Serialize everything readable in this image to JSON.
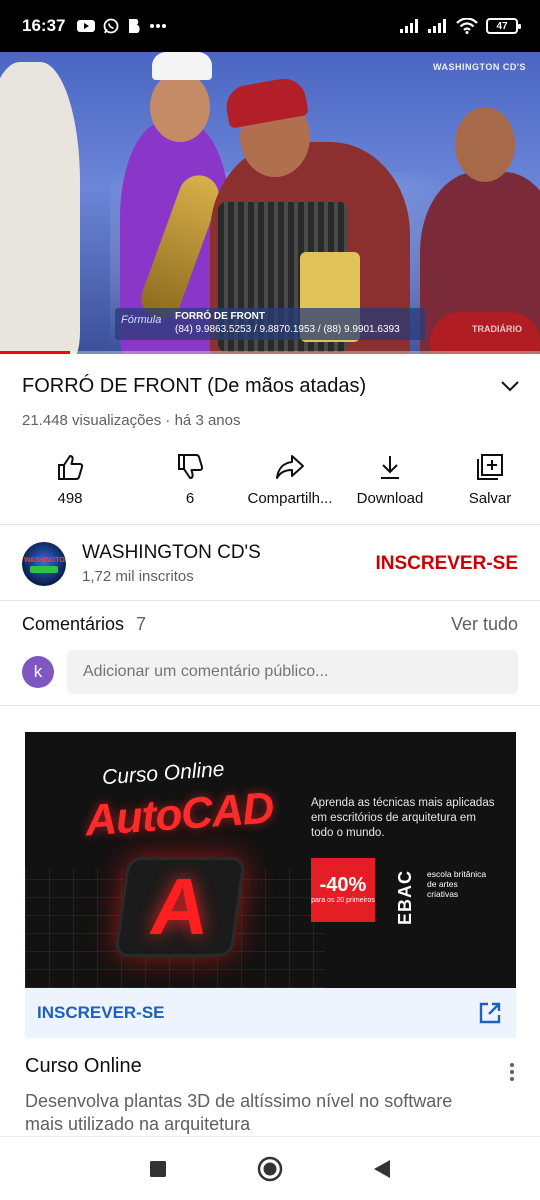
{
  "status_bar": {
    "time": "16:37",
    "left_icons": [
      "youtube-icon",
      "whatsapp-icon",
      "app-b-icon",
      "more-dots-icon"
    ],
    "right_icons": [
      "signal-icon",
      "signal-icon",
      "wifi-icon",
      "battery-icon"
    ],
    "battery": "47"
  },
  "video": {
    "watermark": "WASHINGTON CD'S",
    "lower_third_logo": "Fórmula",
    "lower_third_title": "FORRÓ DE FRONT",
    "lower_third_phones": "(84) 9.9863.5253 / 9.8870.1953 / (88) 9.9901.6393",
    "corner_logo": "TRADIÁRIO",
    "progress": 0.13
  },
  "title": "FORRÓ DE FRONT (De mãos atadas)",
  "meta": "21.448 visualizações · há 3 anos",
  "actions": [
    {
      "icon": "thumbs-up-icon",
      "label": "498"
    },
    {
      "icon": "thumbs-down-icon",
      "label": "6"
    },
    {
      "icon": "share-icon",
      "label": "Compartilh..."
    },
    {
      "icon": "download-icon",
      "label": "Download"
    },
    {
      "icon": "save-playlist-icon",
      "label": "Salvar"
    }
  ],
  "channel": {
    "avatar_text": "WASHINGTON",
    "name": "WASHINGTON CD'S",
    "subscribers": "1,72 mil inscritos",
    "subscribe_label": "INSCREVER-SE"
  },
  "comments": {
    "title": "Comentários",
    "count": "7",
    "see_all": "Ver tudo",
    "user_initial": "k",
    "placeholder": "Adicionar um comentário público..."
  },
  "ad": {
    "course": "Curso Online",
    "product": "AutoCAD",
    "logo_letter": "A",
    "description": "Aprenda as técnicas mais aplicadas em escritórios de arquitetura em todo o mundo.",
    "discount": "-40%",
    "discount_note": "para os 20 primeiros",
    "brand_mark": "EBAC",
    "brand_text": "escola britânica de artes criativas",
    "cta_label": "INSCREVER-SE",
    "headline": "Curso Online",
    "body": "Desenvolva plantas 3D de altíssimo nível no software mais utilizado na arquitetura"
  },
  "nav": [
    "recents-square-icon",
    "home-circle-icon",
    "back-triangle-icon"
  ]
}
